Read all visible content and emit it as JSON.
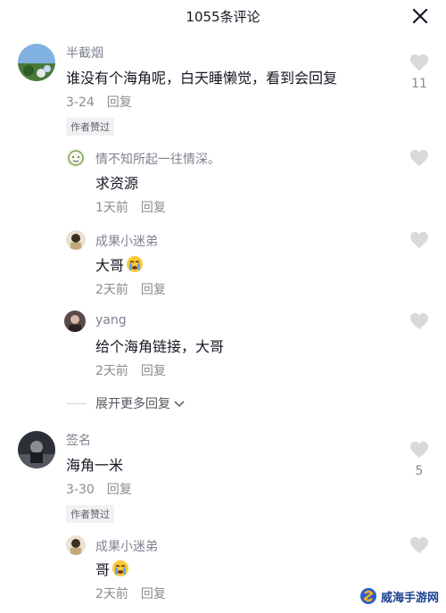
{
  "header": {
    "title": "1055条评论"
  },
  "comments": [
    {
      "name": "半截烟",
      "text": "谁没有个海角呢，白天睡懒觉，看到会回复",
      "date": "3-24",
      "reply_label": "回复",
      "badge": "作者赞过",
      "like_count": "11"
    },
    {
      "name": "签名",
      "text": "海角一米",
      "date": "3-30",
      "reply_label": "回复",
      "badge": "作者赞过",
      "like_count": "5"
    }
  ],
  "replies": [
    {
      "name": "情不知所起一往情深。",
      "text": "求资源",
      "date": "1天前",
      "reply_label": "回复"
    },
    {
      "name": "成果小迷弟",
      "text": "大哥",
      "date": "2天前",
      "reply_label": "回复",
      "emoji": "crying-face-icon"
    },
    {
      "name": "yang",
      "text": "给个海角链接，大哥",
      "date": "2天前",
      "reply_label": "回复"
    },
    {
      "name": "成果小迷弟",
      "text": "哥",
      "date": "2天前",
      "reply_label": "回复",
      "emoji": "crying-face-icon"
    }
  ],
  "expand_label": "展开更多回复",
  "watermark": {
    "text": "威海手游网"
  },
  "colors": {
    "text": "#161823",
    "secondary": "#8a8b91",
    "heart": "#d9d9dc",
    "badge_bg": "#f1f1f3"
  }
}
